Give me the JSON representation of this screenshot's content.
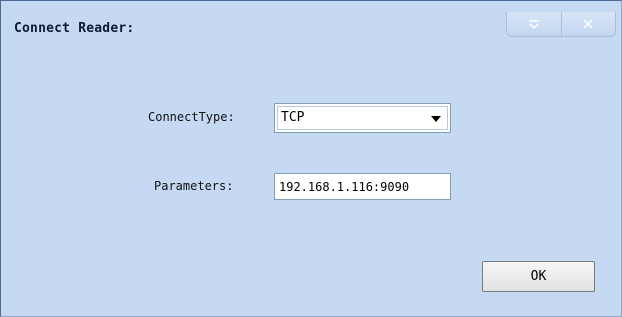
{
  "window": {
    "title": "Connect Reader:",
    "minimize_icon": "dropdown-minimize-icon",
    "close_icon": "close-icon"
  },
  "form": {
    "connect_type_label": "ConnectType:",
    "connect_type_value": "TCP",
    "parameters_label": "Parameters:",
    "parameters_value": "192.168.1.116:9090"
  },
  "actions": {
    "ok_label": "OK"
  },
  "colors": {
    "window_background": "#c6d9f3",
    "field_background": "#ffffff"
  }
}
